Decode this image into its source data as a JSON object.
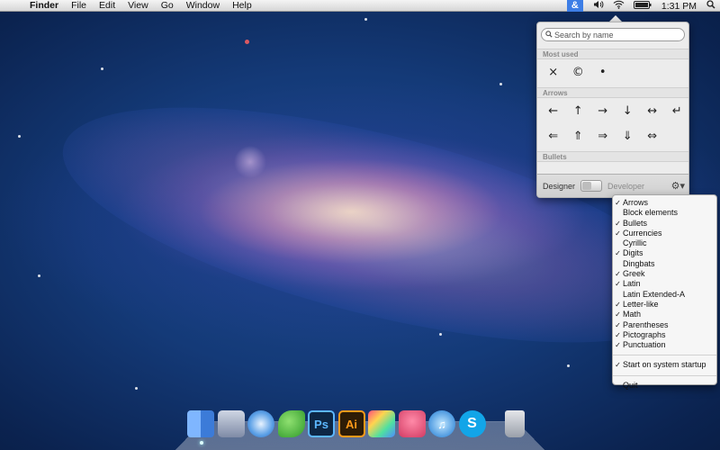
{
  "menubar": {
    "apple_glyph": "",
    "items": [
      "Finder",
      "File",
      "Edit",
      "View",
      "Go",
      "Window",
      "Help"
    ],
    "status_app_glyph": "&",
    "clock": "1:31 PM"
  },
  "popover": {
    "search_placeholder": "Search by name",
    "sections": {
      "most_used": "Most used",
      "arrows": "Arrows",
      "bullets": "Bullets"
    },
    "most_used_symbols": [
      "×",
      "©",
      "•"
    ],
    "arrows_row1": [
      "←",
      "↑",
      "→",
      "↓",
      "↔",
      "↵"
    ],
    "arrows_row2": [
      "⇐",
      "⇑",
      "⇒",
      "⇓",
      "⇔"
    ],
    "designer_label": "Designer",
    "developer_label": "Developer",
    "gear_glyph": "⚙▾"
  },
  "dropdown": {
    "items": [
      {
        "label": "Arrows",
        "checked": "✓"
      },
      {
        "label": "Block elements",
        "checked": ""
      },
      {
        "label": "Bullets",
        "checked": "✓"
      },
      {
        "label": "Currencies",
        "checked": "✓"
      },
      {
        "label": "Cyrillic",
        "checked": ""
      },
      {
        "label": "Digits",
        "checked": "✓"
      },
      {
        "label": "Dingbats",
        "checked": ""
      },
      {
        "label": "Greek",
        "checked": "✓"
      },
      {
        "label": "Latin",
        "checked": "✓"
      },
      {
        "label": "Latin Extended-A",
        "checked": ""
      },
      {
        "label": "Letter-like",
        "checked": "✓"
      },
      {
        "label": "Math",
        "checked": "✓"
      },
      {
        "label": "Parentheses",
        "checked": "✓"
      },
      {
        "label": "Pictographs",
        "checked": "✓"
      },
      {
        "label": "Punctuation",
        "checked": "✓"
      }
    ],
    "startup": {
      "label": "Start on system startup",
      "checked": "✓"
    },
    "quit": "Quit"
  },
  "dock": {
    "apps": [
      {
        "name": "Finder",
        "glyph": ""
      },
      {
        "name": "Preview",
        "glyph": ""
      },
      {
        "name": "Safari",
        "glyph": ""
      },
      {
        "name": "Leaf",
        "glyph": ""
      },
      {
        "name": "Photoshop",
        "glyph": "Ps"
      },
      {
        "name": "Illustrator",
        "glyph": "Ai"
      },
      {
        "name": "Color",
        "glyph": ""
      },
      {
        "name": "Cake",
        "glyph": ""
      },
      {
        "name": "iTunes",
        "glyph": "♫"
      },
      {
        "name": "Skype",
        "glyph": "S"
      },
      {
        "name": "Trash",
        "glyph": ""
      }
    ]
  }
}
